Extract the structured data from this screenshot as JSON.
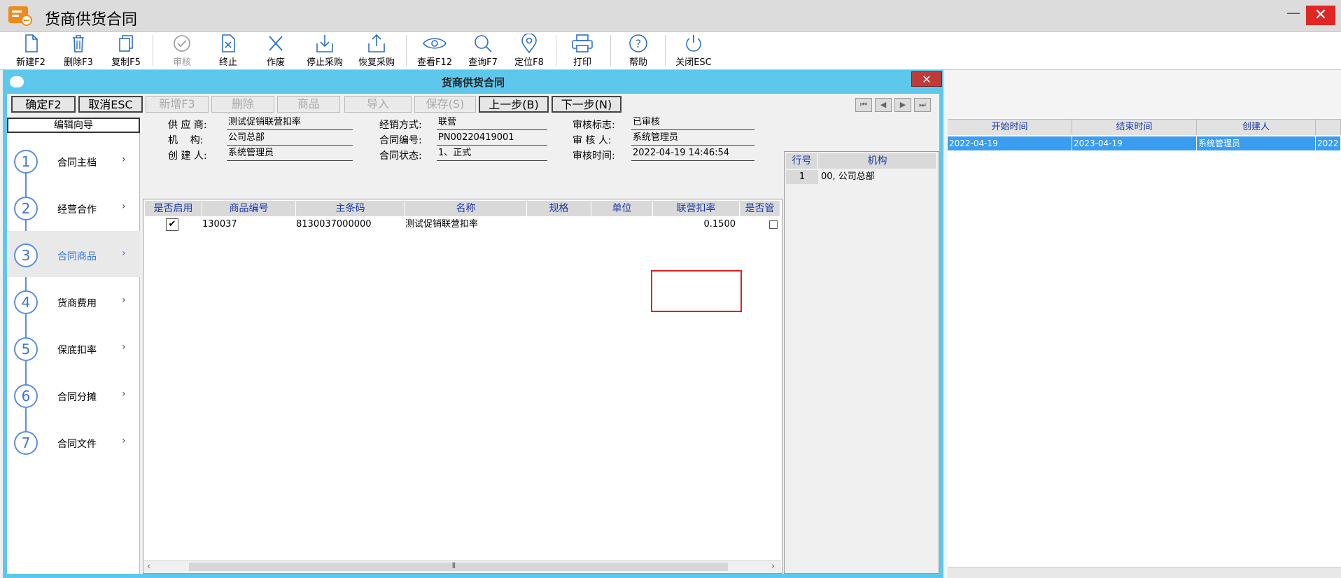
{
  "app": {
    "title": "货商供货合同"
  },
  "toolbar": {
    "buttons": [
      {
        "label": "新建F2",
        "icon": "new-file-icon",
        "enabled": true
      },
      {
        "label": "删除F3",
        "icon": "trash-icon",
        "enabled": true
      },
      {
        "label": "复制F5",
        "icon": "copy-icon",
        "enabled": true
      },
      {
        "label": "审核",
        "icon": "check-circle-icon",
        "enabled": false
      },
      {
        "label": "终止",
        "icon": "doc-x-icon",
        "enabled": true
      },
      {
        "label": "作废",
        "icon": "x-icon",
        "enabled": true
      },
      {
        "label": "停止采购",
        "icon": "download-tray-icon",
        "enabled": true
      },
      {
        "label": "恢复采购",
        "icon": "upload-tray-icon",
        "enabled": true
      },
      {
        "label": "查看F12",
        "icon": "eye-icon",
        "enabled": true
      },
      {
        "label": "查询F7",
        "icon": "magnifier-icon",
        "enabled": true
      },
      {
        "label": "定位F8",
        "icon": "location-pin-icon",
        "enabled": true
      },
      {
        "label": "打印",
        "icon": "printer-icon",
        "enabled": true
      },
      {
        "label": "帮助",
        "icon": "help-circle-icon",
        "enabled": true
      },
      {
        "label": "关闭ESC",
        "icon": "power-icon",
        "enabled": true
      }
    ]
  },
  "background_grid": {
    "headers": [
      "开始时间",
      "结束时间",
      "创建人",
      ""
    ],
    "row": [
      "2022-04-19",
      "2023-04-19",
      "系统管理员",
      "2022"
    ]
  },
  "dialog": {
    "title": "货商供货合同",
    "close_label": "✕",
    "actions": {
      "confirm": "确定F2",
      "cancel": "取消ESC",
      "add": "新增F3",
      "delete": "删除",
      "goods": "商品",
      "import": "导入",
      "save": "保存(S)",
      "prev": "上一步(B)",
      "next": "下一步(N)"
    },
    "wizard": {
      "header": "编辑向导",
      "active_step": 3,
      "steps": [
        {
          "num": "1",
          "label": "合同主档"
        },
        {
          "num": "2",
          "label": "经营合作"
        },
        {
          "num": "3",
          "label": "合同商品"
        },
        {
          "num": "4",
          "label": "货商费用"
        },
        {
          "num": "5",
          "label": "保底扣率"
        },
        {
          "num": "6",
          "label": "合同分摊"
        },
        {
          "num": "7",
          "label": "合同文件"
        }
      ]
    },
    "info": {
      "supplier_label": "供 应 商:",
      "supplier": "测试促销联营扣率",
      "org_label": "机    构:",
      "org": "公司总部",
      "creator_label": "创 建 人:",
      "creator": "系统管理员",
      "sale_mode_label": "经销方式:",
      "sale_mode": "联营",
      "contract_no_label": "合同编号:",
      "contract_no": "PN00220419001",
      "contract_status_label": "合同状态:",
      "contract_status": "1、正式",
      "audit_flag_label": "审核标志:",
      "audit_flag": "已审核",
      "auditor_label": "审 核 人:",
      "auditor": "系统管理员",
      "audit_time_label": "审核时间:",
      "audit_time": "2022-04-19 14:46:54"
    },
    "goods_grid": {
      "headers": [
        "是否启用",
        "商品编号",
        "主条码",
        "名称",
        "规格",
        "单位",
        "联营扣率",
        "是否管"
      ],
      "rows": [
        {
          "enabled": true,
          "code": "130037",
          "barcode": "8130037000000",
          "name": "测试促销联营扣率",
          "spec": "",
          "unit": "",
          "rate": "0.1500",
          "managed": false
        }
      ],
      "scroll_glyph": "⦀"
    },
    "org_grid": {
      "headers": [
        "行号",
        "机构"
      ],
      "rows": [
        {
          "num": "1",
          "org": "00, 公司总部"
        }
      ]
    }
  }
}
